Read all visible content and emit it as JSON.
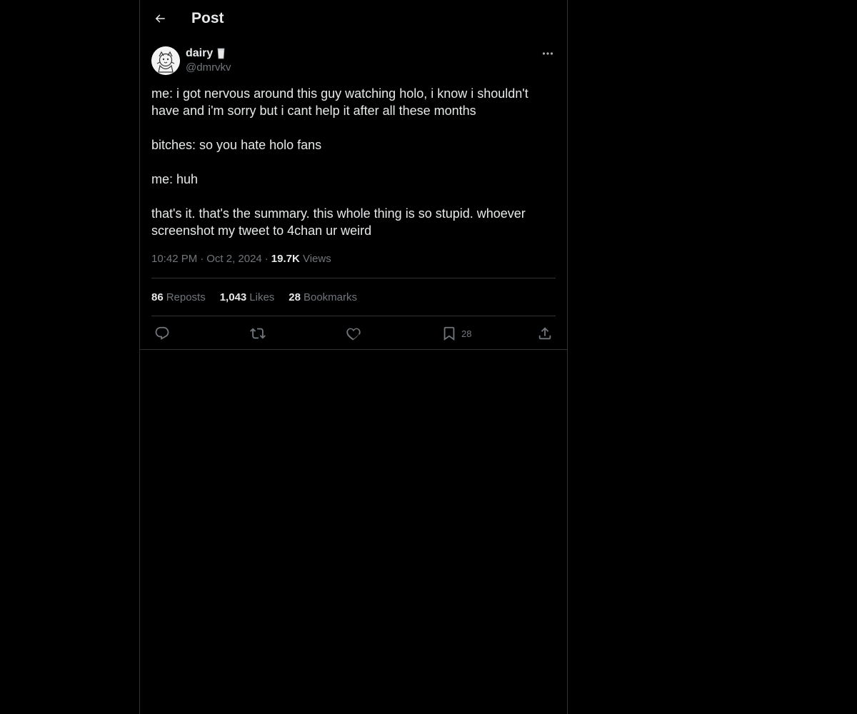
{
  "header": {
    "title": "Post",
    "back_icon": "arrow-left-icon"
  },
  "post": {
    "author": {
      "display_name": "dairy",
      "handle": "@dmrvkv",
      "name_emoji": "milk-glass-icon"
    },
    "body": [
      "me: i got nervous around this guy watching holo, i know i shouldn't have and i'm sorry but i cant help it after all these months",
      "bitches: so you hate holo fans",
      "me: huh",
      "that's it. that's the summary. this whole thing is so stupid. whoever screenshot my tweet to 4chan ur weird"
    ],
    "time": "10:42 PM",
    "date": "Oct 2, 2024",
    "views_count": "19.7K",
    "views_label": "Views",
    "separator": "·"
  },
  "stats": {
    "reposts": {
      "count": "86",
      "label": "Reposts"
    },
    "likes": {
      "count": "1,043",
      "label": "Likes"
    },
    "bookmarks": {
      "count": "28",
      "label": "Bookmarks"
    }
  },
  "actions": {
    "reply_icon": "reply-icon",
    "repost_icon": "repost-icon",
    "like_icon": "heart-icon",
    "bookmark_icon": "bookmark-icon",
    "bookmark_count": "28",
    "share_icon": "share-icon"
  },
  "colors": {
    "background": "#000000",
    "text": "#e7e9ea",
    "muted": "#71767b",
    "border": "#2f3336"
  }
}
